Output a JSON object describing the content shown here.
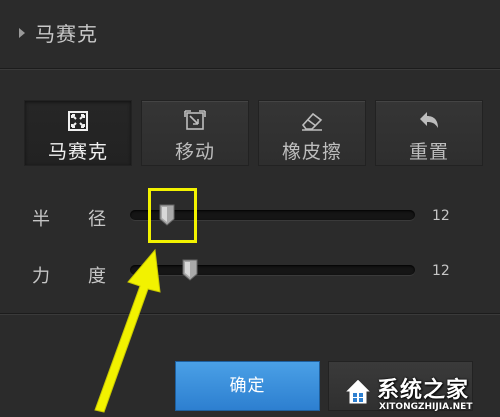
{
  "section": {
    "title": "马赛克",
    "expand_icon": "triangle-right-icon"
  },
  "tools": [
    {
      "label": "马赛克",
      "icon": "mosaic-icon",
      "active": true
    },
    {
      "label": "移动",
      "icon": "move-icon",
      "active": false
    },
    {
      "label": "橡皮擦",
      "icon": "eraser-icon",
      "active": false
    },
    {
      "label": "重置",
      "icon": "undo-arrow-icon",
      "active": false
    }
  ],
  "sliders": [
    {
      "label_char1": "半",
      "label_char2": "径",
      "value": "12",
      "level": 0.13
    },
    {
      "label_char1": "力",
      "label_char2": "度",
      "value": "12",
      "level": 0.21
    }
  ],
  "buttons": {
    "confirm_label": "确定"
  },
  "watermark": {
    "title": "系统之家",
    "url": "XITONGZHIJIA.NET"
  },
  "colors": {
    "accent_blue": "#2d7fd0",
    "highlight_yellow": "#f2f200",
    "panel_bg": "#2b2b2b"
  }
}
